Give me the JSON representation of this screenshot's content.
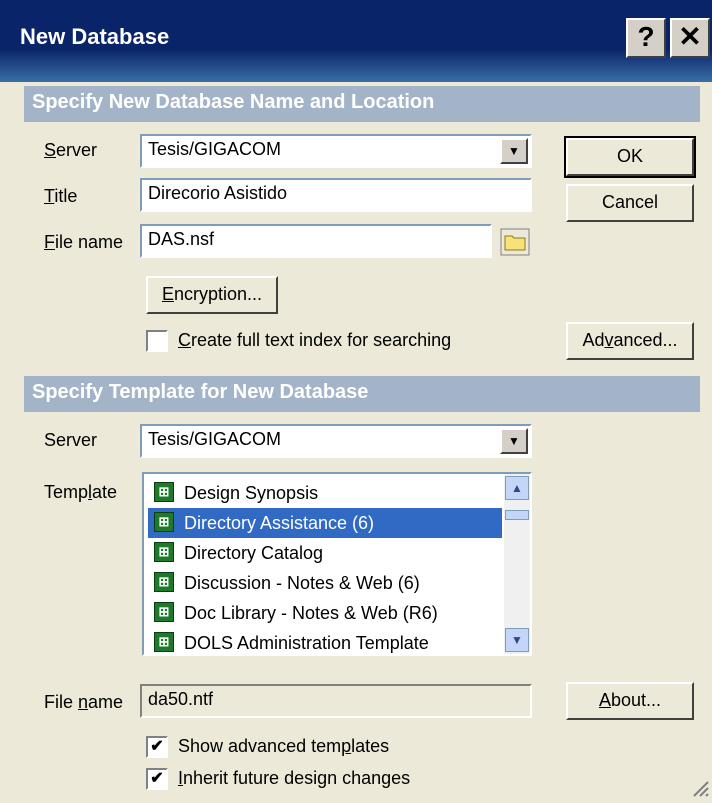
{
  "dialog": {
    "title": "New Database",
    "help_label": "?",
    "close_label": "✕"
  },
  "new_db": {
    "header": "Specify New Database Name and Location",
    "server_label_u": "S",
    "server_label_rest": "erver",
    "server_value": "Tesis/GIGACOM",
    "title_label_u": "T",
    "title_label_rest": "itle",
    "title_value": "Direcorio Asistido",
    "filename_label_u": "F",
    "filename_label_rest": "ile name",
    "filename_value": "DAS.nsf",
    "encryption_u": "E",
    "encryption_rest": "ncryption...",
    "fulltext_u": "C",
    "fulltext_rest": "reate full text index for searching",
    "fulltext_checked": false
  },
  "buttons": {
    "ok": "OK",
    "cancel": "Cancel",
    "advanced_pre": "Ad",
    "advanced_u": "v",
    "advanced_post": "anced...",
    "about_u": "A",
    "about_rest": "bout..."
  },
  "template": {
    "header": "Specify Template for New Database",
    "server_label": "Server",
    "server_value": "Tesis/GIGACOM",
    "template_label_pre": "Temp",
    "template_label_u": "l",
    "template_label_post": "ate",
    "items": [
      {
        "label": "Design Synopsis",
        "selected": false
      },
      {
        "label": "Directory Assistance (6)",
        "selected": true
      },
      {
        "label": "Directory Catalog",
        "selected": false
      },
      {
        "label": "Discussion - Notes & Web (6)",
        "selected": false
      },
      {
        "label": "Doc Library - Notes & Web (R6)",
        "selected": false
      },
      {
        "label": "DOLS Administration Template",
        "selected": false
      }
    ],
    "filename_label_pre": "File ",
    "filename_label_u": "n",
    "filename_label_post": "ame",
    "filename_value": "da50.ntf",
    "show_advanced_pre": "Show advanced tem",
    "show_advanced_u": "p",
    "show_advanced_post": "lates",
    "show_advanced_checked": true,
    "inherit_u": "I",
    "inherit_rest": "nherit future design changes",
    "inherit_checked": true
  },
  "icons": {
    "template_icon": "notes-template-icon",
    "folder_icon": "folder-icon",
    "dropdown_icon": "chevron-down-icon",
    "check_mark": "✔"
  }
}
